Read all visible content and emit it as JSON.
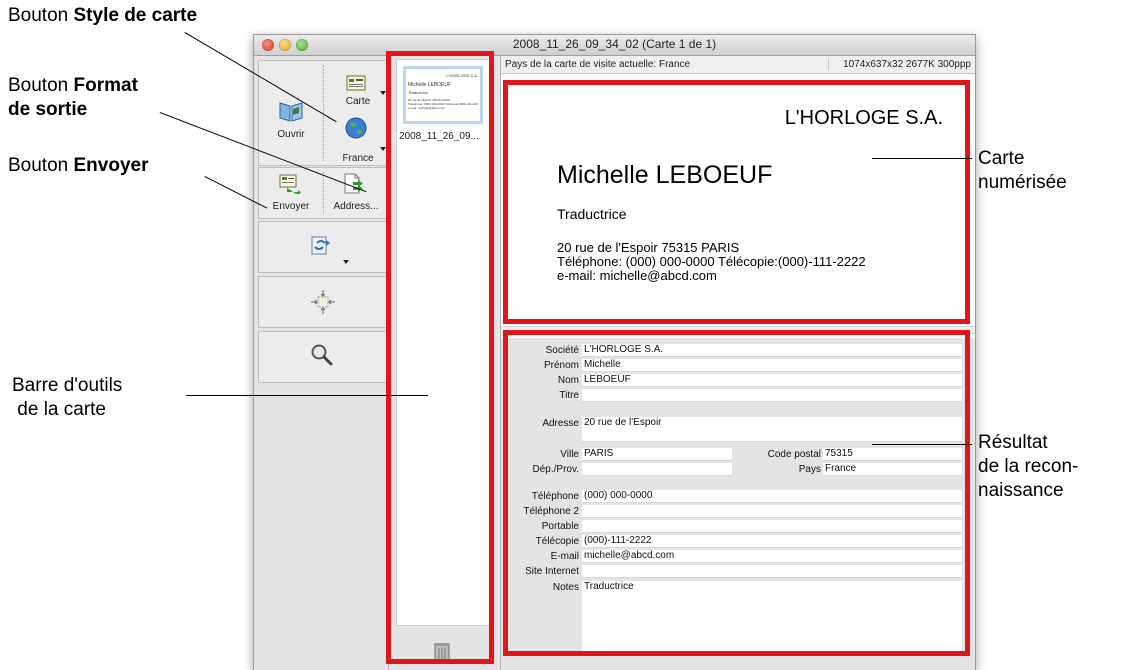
{
  "annotations": {
    "style_prefix": "Bouton ",
    "style_bold": "Style de carte",
    "format_prefix": "Bouton ",
    "format_bold_1": "Format",
    "format_bold_2": "de sortie",
    "send_prefix": "Bouton ",
    "send_bold": "Envoyer",
    "toolbar_1": "Barre d'outils",
    "toolbar_2": "de la carte",
    "scanned_1": "Carte",
    "scanned_2": "numérisée",
    "result_1": "Résultat",
    "result_2": "de la recon-",
    "result_3": "naissance"
  },
  "window": {
    "title": "2008_11_26_09_34_02 (Carte 1 de 1)"
  },
  "toolbar": {
    "open_label": "Ouvrir",
    "card_label": "Carte",
    "country_label": "France",
    "send_label": "Envoyer",
    "address_label": "Address..."
  },
  "thumbnail": {
    "filename": "2008_11_26_09...",
    "mini_company": "L'HORLOGE S.A.",
    "mini_name": "Michelle LEBOEUF",
    "mini_job": "Traductrice",
    "mini_lines": [
      "20 rue de l'Espoir 75315 PARIS",
      "Téléphone: (000) 000-0000  Télécopie:(000)-111-2222",
      "e-mail: michelle@abcd.com"
    ]
  },
  "info": {
    "country": "Pays de la carte de visite actuelle: France",
    "details": "1074x637x32  2677K  300ppp"
  },
  "card": {
    "company": "L'HORLOGE S.A.",
    "name": "Michelle LEBOEUF",
    "job": "Traductrice",
    "address": "20 rue de l'Espoir 75315 PARIS",
    "phones": "Téléphone: (000) 000-0000   Télécopie:(000)-111-2222",
    "email": "e-mail: michelle@abcd.com"
  },
  "form": {
    "societe_label": "Société",
    "societe": "L'HORLOGE S.A.",
    "prenom_label": "Prénom",
    "prenom": "Michelle",
    "nom_label": "Nom",
    "nom": "LEBOEUF",
    "titre_label": "Titre",
    "titre": "",
    "adresse_label": "Adresse",
    "adresse": "20 rue de l'Espoir",
    "ville_label": "Ville",
    "ville": "PARIS",
    "cp_label": "Code postal",
    "cp": "75315",
    "dep_label": "Dép./Prov.",
    "dep": "",
    "pays_label": "Pays",
    "pays": "France",
    "tel_label": "Téléphone",
    "tel": "(000) 000-0000",
    "tel2_label": "Téléphone 2",
    "tel2": "",
    "portable_label": "Portable",
    "portable": "",
    "telecopie_label": "Télécopie",
    "telecopie": "(000)-111-2222",
    "email_label": "E-mail",
    "email": "michelle@abcd.com",
    "site_label": "Site Internet",
    "site": "",
    "notes_label": "Notes",
    "notes": "Traductrice"
  },
  "colors": {
    "highlight": "#e3151b",
    "selection": "#bcd5f5"
  }
}
